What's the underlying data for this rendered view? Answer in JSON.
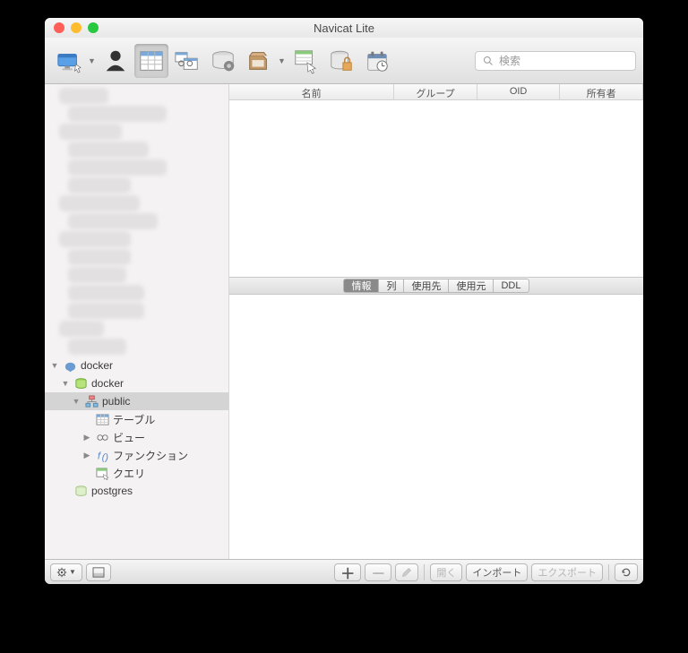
{
  "window": {
    "title": "Navicat Lite"
  },
  "search": {
    "placeholder": "検索"
  },
  "columns": {
    "name": "名前",
    "group": "グループ",
    "oid": "OID",
    "owner": "所有者"
  },
  "tabs": {
    "info": "情報",
    "column": "列",
    "used_in": "使用先",
    "uses": "使用元",
    "ddl": "DDL"
  },
  "tree": {
    "docker_conn": "docker",
    "docker_db": "docker",
    "public": "public",
    "table": "テーブル",
    "view": "ビュー",
    "function": "ファンクション",
    "query": "クエリ",
    "postgres": "postgres"
  },
  "bottom": {
    "open": "開く",
    "import": "インポート",
    "export": "エクスポート"
  }
}
